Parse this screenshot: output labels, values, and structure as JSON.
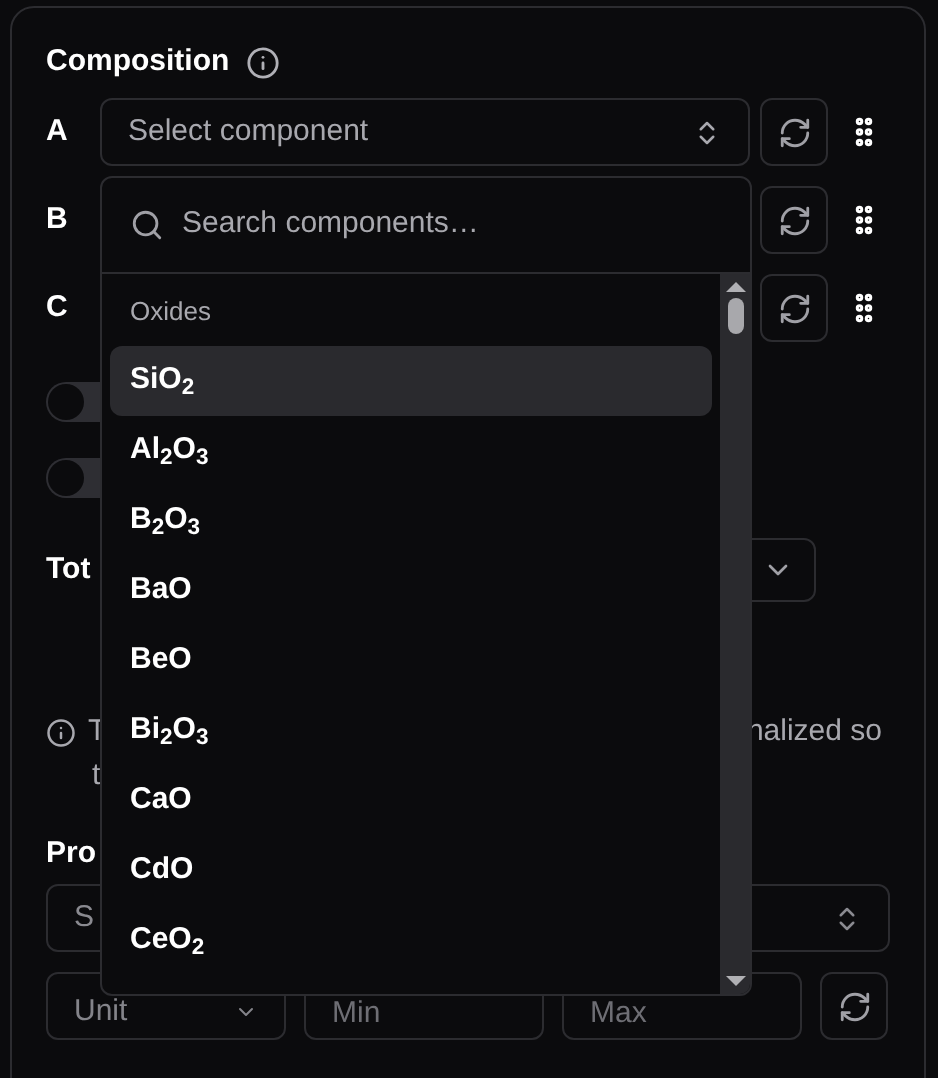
{
  "section": {
    "title": "Composition"
  },
  "components": [
    {
      "label": "A",
      "placeholder": "Select component"
    },
    {
      "label": "B"
    },
    {
      "label": "C"
    }
  ],
  "toggles": [
    {
      "on": false
    },
    {
      "on": false
    }
  ],
  "total": {
    "label": "Tot"
  },
  "note": {
    "line_1_start": "T",
    "line_1_end": "nalized so",
    "line_2": "t"
  },
  "properties": {
    "label": "Pro",
    "select_placeholder": "S",
    "unit_placeholder": "Unit",
    "min_placeholder": "Min",
    "max_placeholder": "Max"
  },
  "dropdown": {
    "search_placeholder": "Search components…",
    "groups": [
      {
        "label": "Oxides",
        "items": [
          {
            "name": "SiO$_{2}$",
            "selected": true
          },
          {
            "name": "Al$_{2}$O$_{3}$",
            "selected": false
          },
          {
            "name": "B$_{2}$O$_{3}$",
            "selected": false
          },
          {
            "name": "BaO",
            "selected": false
          },
          {
            "name": "BeO",
            "selected": false
          },
          {
            "name": "Bi$_{2}$O$_{3}$",
            "selected": false
          },
          {
            "name": "CaO",
            "selected": false
          },
          {
            "name": "CdO",
            "selected": false
          },
          {
            "name": "CeO$_{2}$",
            "selected": false
          }
        ]
      }
    ]
  }
}
